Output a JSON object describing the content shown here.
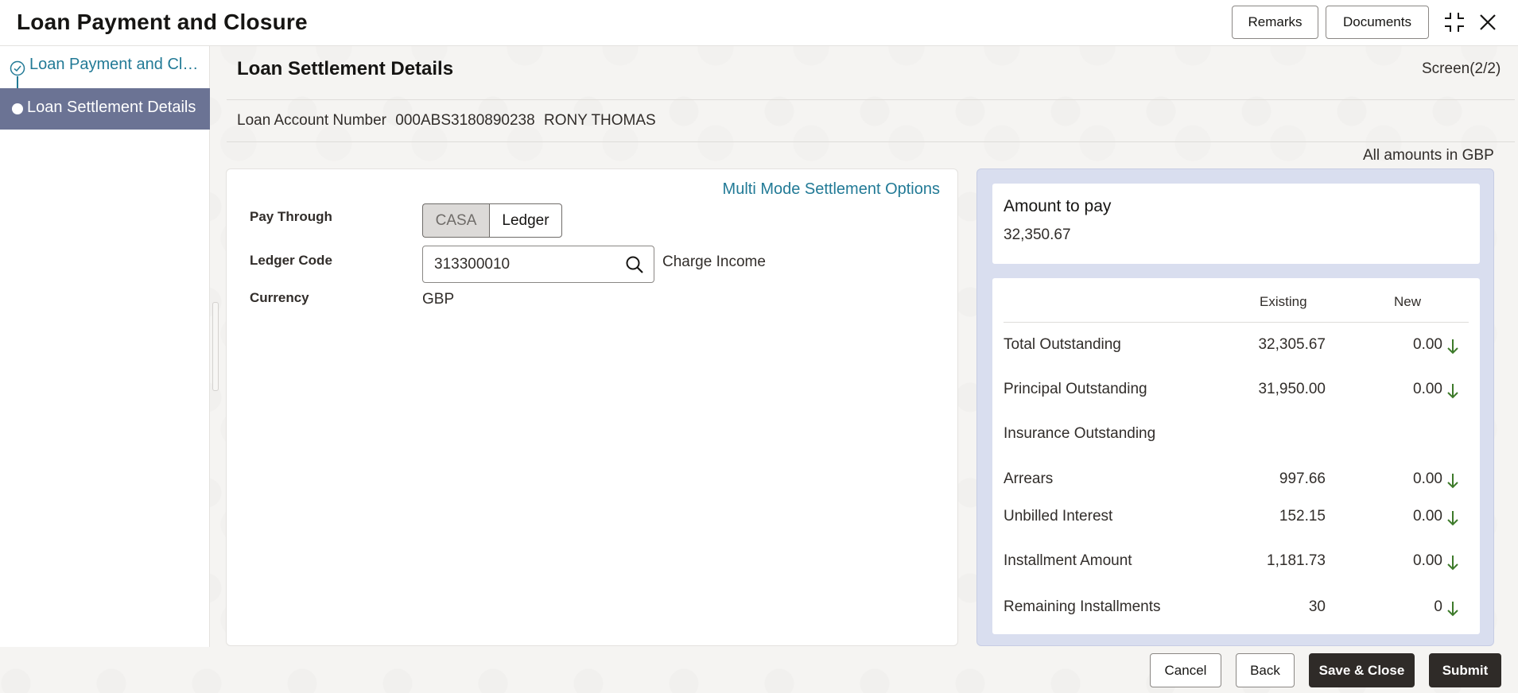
{
  "header": {
    "title": "Loan Payment and Closure",
    "remarks_label": "Remarks",
    "documents_label": "Documents"
  },
  "nav": {
    "items": [
      {
        "label": "Loan Payment and Closure",
        "state": "completed"
      },
      {
        "label": "Loan Settlement Details",
        "state": "active"
      }
    ]
  },
  "main": {
    "title": "Loan Settlement Details",
    "screen": "Screen(2/2)",
    "loan_account_label": "Loan Account Number",
    "loan_account_number": "000ABS3180890238",
    "customer_name": "RONY THOMAS",
    "amounts_note": "All amounts in GBP"
  },
  "form": {
    "multi_mode_link": "Multi Mode Settlement Options",
    "pay_through_label": "Pay Through",
    "pay_through_options": [
      "CASA",
      "Ledger"
    ],
    "pay_through_selected": "Ledger",
    "ledger_code_label": "Ledger Code",
    "ledger_code_value": "313300010",
    "ledger_code_desc": "Charge Income",
    "currency_label": "Currency",
    "currency_value": "GBP"
  },
  "summary": {
    "amount_to_pay_label": "Amount to pay",
    "amount_to_pay_value": "32,350.67",
    "col_existing": "Existing",
    "col_new": "New",
    "rows": [
      {
        "label": "Total Outstanding",
        "existing": "32,305.67",
        "new": "0.00"
      },
      {
        "label": "Principal Outstanding",
        "existing": "31,950.00",
        "new": "0.00"
      },
      {
        "label": "Insurance Outstanding",
        "existing": "",
        "new": ""
      },
      {
        "label": "Arrears",
        "existing": "997.66",
        "new": "0.00"
      },
      {
        "label": "Unbilled Interest",
        "existing": "152.15",
        "new": "0.00"
      },
      {
        "label": "Installment Amount",
        "existing": "1,181.73",
        "new": "0.00"
      },
      {
        "label": "Remaining Installments",
        "existing": "30",
        "new": "0"
      }
    ]
  },
  "footer": {
    "cancel_label": "Cancel",
    "back_label": "Back",
    "save_close_label": "Save & Close",
    "submit_label": "Submit"
  },
  "colors": {
    "accent_link": "#227a96",
    "nav_active_bg": "#6b7394",
    "panel_bg": "#d9deef",
    "primary_button": "#2f2b28",
    "arrow_down": "#3d7a2a"
  },
  "icons": {
    "collapse": "collapse-icon",
    "close": "close-icon",
    "search": "search-icon",
    "completed_step": "check-circle-icon",
    "decrease": "arrow-down-icon"
  }
}
